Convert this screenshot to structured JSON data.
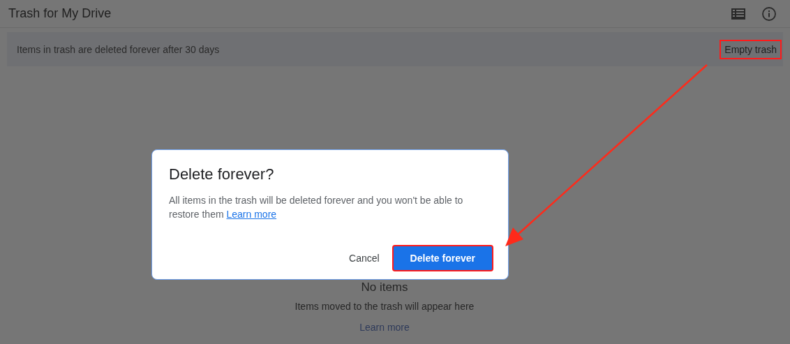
{
  "header": {
    "title": "Trash for My Drive"
  },
  "banner": {
    "text": "Items in trash are deleted forever after 30 days",
    "action": {
      "label": "Empty trash",
      "highlighted": true
    }
  },
  "empty_state": {
    "title": "No items",
    "text": "Items moved to the trash will appear here",
    "link": "Learn more"
  },
  "dialog": {
    "title": "Delete forever?",
    "body": "All items in the trash will be deleted forever and you won't be able to restore them",
    "link": "Learn more",
    "buttons": [
      {
        "label": "Cancel",
        "kind": "text",
        "highlighted": false
      },
      {
        "label": "Delete forever",
        "kind": "primary",
        "highlighted": true
      }
    ]
  }
}
